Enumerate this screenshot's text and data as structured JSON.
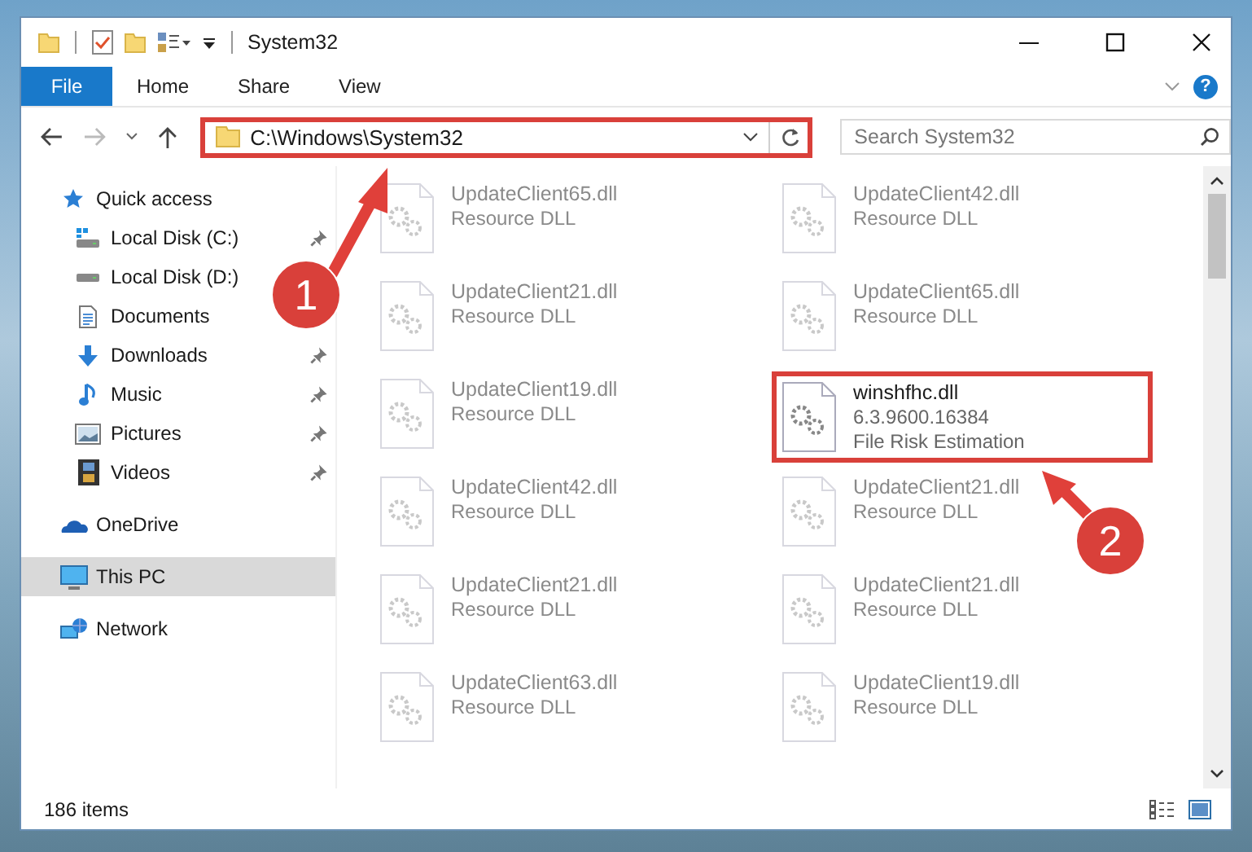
{
  "window": {
    "title": "System32"
  },
  "ribbon": {
    "tabs": [
      {
        "label": "File",
        "kind": "menu",
        "selected": false
      },
      {
        "label": "Home",
        "kind": "tab",
        "selected": false
      },
      {
        "label": "Share",
        "kind": "tab",
        "selected": false
      },
      {
        "label": "View",
        "kind": "tab",
        "selected": false
      }
    ],
    "help": "?"
  },
  "address_bar": {
    "path": "C:\\Windows\\System32",
    "highlighted": true
  },
  "search": {
    "placeholder": "Search System32"
  },
  "sidebar": {
    "items": [
      {
        "label": "Quick access",
        "kind": "star",
        "selected": false,
        "children": [
          {
            "label": "Local Disk (C:)",
            "kind": "system_drive",
            "pinned": true,
            "selected": false
          },
          {
            "label": "Local Disk (D:)",
            "kind": "drive",
            "pinned": false,
            "selected": false
          },
          {
            "label": "Documents",
            "kind": "document",
            "pinned": false,
            "selected": false
          },
          {
            "label": "Downloads",
            "kind": "download",
            "pinned": true,
            "selected": false
          },
          {
            "label": "Music",
            "kind": "music",
            "pinned": true,
            "selected": false
          },
          {
            "label": "Pictures",
            "kind": "pictures",
            "pinned": true,
            "selected": false
          },
          {
            "label": "Videos",
            "kind": "videos",
            "pinned": true,
            "selected": false
          }
        ]
      },
      {
        "label": "OneDrive",
        "kind": "cloud",
        "selected": false
      },
      {
        "label": "This PC",
        "kind": "pc",
        "selected": true
      },
      {
        "label": "Network",
        "kind": "network",
        "selected": false
      }
    ]
  },
  "files": [
    {
      "name": "UpdateClient65.dll",
      "details": [
        "Resource DLL"
      ],
      "dimmed": true,
      "highlighted": false
    },
    {
      "name": "UpdateClient42.dll",
      "details": [
        "Resource DLL"
      ],
      "dimmed": true,
      "highlighted": false
    },
    {
      "name": "UpdateClient21.dll",
      "details": [
        "Resource DLL"
      ],
      "dimmed": true,
      "highlighted": false
    },
    {
      "name": "UpdateClient65.dll",
      "details": [
        "Resource DLL"
      ],
      "dimmed": true,
      "highlighted": false
    },
    {
      "name": "UpdateClient19.dll",
      "details": [
        "Resource DLL"
      ],
      "dimmed": true,
      "highlighted": false
    },
    {
      "name": "winshfhc.dll",
      "details": [
        "6.3.9600.16384",
        "File Risk Estimation"
      ],
      "dimmed": false,
      "highlighted": true
    },
    {
      "name": "UpdateClient42.dll",
      "details": [
        "Resource DLL"
      ],
      "dimmed": true,
      "highlighted": false
    },
    {
      "name": "UpdateClient21.dll",
      "details": [
        "Resource DLL"
      ],
      "dimmed": true,
      "highlighted": false
    },
    {
      "name": "UpdateClient21.dll",
      "details": [
        "Resource DLL"
      ],
      "dimmed": true,
      "highlighted": false
    },
    {
      "name": "UpdateClient21.dll",
      "details": [
        "Resource DLL"
      ],
      "dimmed": true,
      "highlighted": false
    },
    {
      "name": "UpdateClient63.dll",
      "details": [
        "Resource DLL"
      ],
      "dimmed": true,
      "highlighted": false
    },
    {
      "name": "UpdateClient19.dll",
      "details": [
        "Resource DLL"
      ],
      "dimmed": true,
      "highlighted": false
    }
  ],
  "status_bar": {
    "item_count": "186 items"
  },
  "annotations": [
    {
      "label": "1"
    },
    {
      "label": "2"
    }
  ]
}
